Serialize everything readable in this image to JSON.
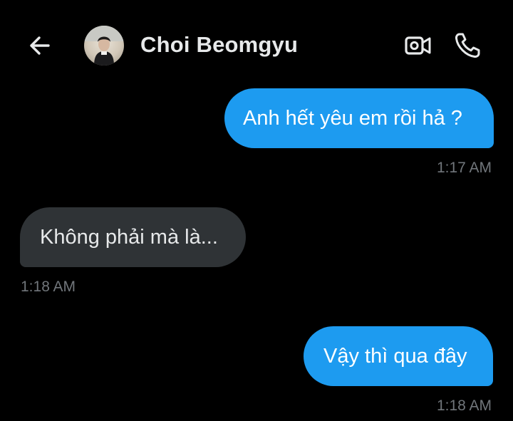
{
  "header": {
    "back_icon": "arrow-left-icon",
    "contact_name": "Choi Beomgyu",
    "video_icon": "video-call-icon",
    "phone_icon": "phone-call-icon"
  },
  "messages": [
    {
      "direction": "sent",
      "text": "Anh hết yêu em rồi hả ?",
      "time": "1:17 AM"
    },
    {
      "direction": "received",
      "text": "Không phải mà là...",
      "time": "1:18 AM"
    },
    {
      "direction": "sent",
      "text": "Vậy thì qua đây",
      "time": "1:18 AM"
    }
  ],
  "colors": {
    "background": "#000000",
    "sent_bubble": "#1d9bf0",
    "received_bubble": "#2f3336",
    "timestamp": "#71767b",
    "text": "#e7e9ea"
  }
}
